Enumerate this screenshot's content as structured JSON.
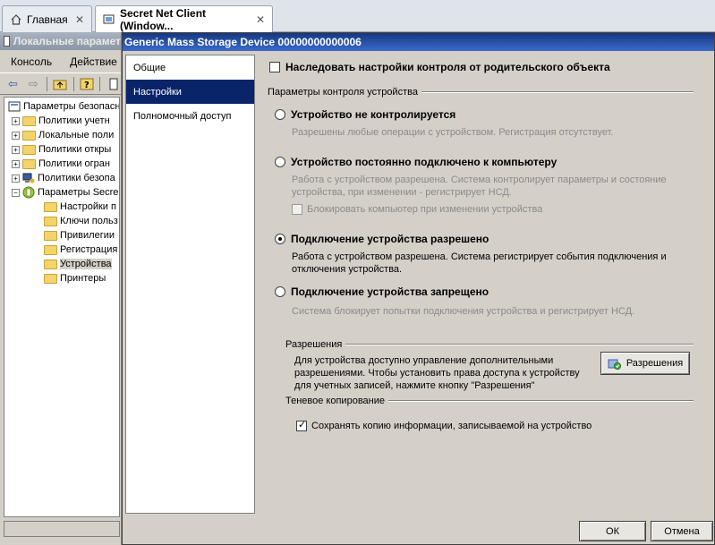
{
  "tabs": [
    {
      "label": "Главная",
      "close": "✕"
    },
    {
      "label": "Secret Net Client (Window...",
      "close": "✕"
    }
  ],
  "mmc": {
    "title": "Локальные парамет",
    "menu": [
      "Консоль",
      "Действие"
    ],
    "tree": [
      {
        "label": "Параметры безопасн",
        "level": 0
      },
      {
        "label": "Политики учетн",
        "level": 1,
        "expander": "+"
      },
      {
        "label": "Локальные поли",
        "level": 1,
        "expander": "+"
      },
      {
        "label": "Политики откры",
        "level": 1,
        "expander": "+"
      },
      {
        "label": "Политики огран",
        "level": 1,
        "expander": "+"
      },
      {
        "label": "Политики безопа",
        "level": 1,
        "expander": "+"
      },
      {
        "label": "Параметры Secre",
        "level": 1,
        "expander": "−"
      },
      {
        "label": "Настройки п",
        "level": 2
      },
      {
        "label": "Ключи польз",
        "level": 2
      },
      {
        "label": "Привилегии",
        "level": 2
      },
      {
        "label": "Регистрация",
        "level": 2
      },
      {
        "label": "Устройства",
        "level": 2,
        "selected": true
      },
      {
        "label": "Принтеры",
        "level": 2
      }
    ]
  },
  "dialog": {
    "title": "Generic Mass Storage Device 00000000000006",
    "nav": [
      "Общие",
      "Настройки",
      "Полномочный доступ"
    ],
    "inherit_label": "Наследовать настройки контроля от родительского объекта",
    "control_group": "Параметры контроля устройства",
    "options": [
      {
        "label": "Устройство не контролируется",
        "desc": "Разрешены любые операции с устройством. Регистрация отсутствует."
      },
      {
        "label": "Устройство постоянно подключено к компьютеру",
        "desc": "Работа с устройством разрешена. Система контролирует параметры и состояние устройства, при изменении - регистрирует НСД."
      },
      {
        "label": "Подключение устройства разрешено",
        "desc": "Работа с устройством разрешена. Система регистрирует события подключения и отключения устройства."
      },
      {
        "label": "Подключение устройства запрещено",
        "desc": "Система блокирует попытки подключения устройства и регистрирует НСД."
      }
    ],
    "block_label": "Блокировать компьютер при изменении устройства",
    "permissions_group": "Разрешения",
    "permissions_desc": "Для устройства доступно управление дополнительными разрешениями.  Чтобы установить права доступа к устройству для учетных записей, нажмите кнопку \"Разрешения\"",
    "permissions_button": "Разрешения",
    "shadow_group": "Теневое копирование",
    "shadow_label": "Сохранять копию информации, записываемой на устройство",
    "ok": "ОК",
    "cancel": "Отмена"
  }
}
